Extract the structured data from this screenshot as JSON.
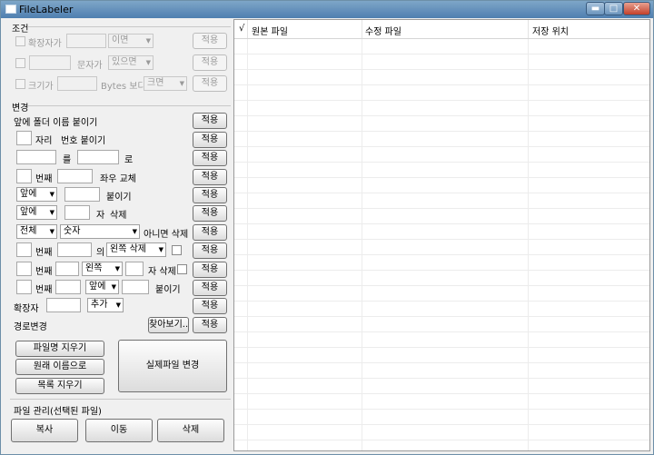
{
  "window": {
    "title": "FileLabeler",
    "min_glyph": "▬",
    "max_glyph": "□",
    "close_glyph": "✕"
  },
  "conditions": {
    "section_label": "조건",
    "ext_label": "확장자가",
    "ext_op": "이면",
    "char_op_label": "문자가",
    "char_op": "있으면",
    "size_label": "크기가",
    "size_unit": "Bytes 보다",
    "size_op": "크면"
  },
  "change": {
    "section_label": "변경",
    "folder_prefix_label": "앞에 폴더 이름 붙이기",
    "digit_label": "자리",
    "number_label": "번호 붙이기",
    "replace_mid": "를",
    "replace_end": "로",
    "swap_nth": "번째",
    "swap_label": "좌우 교체",
    "attach_pos": "앞에",
    "attach_label": "붙이기",
    "delete_pos": "앞에",
    "delete_ch": "자",
    "delete_label": "삭제",
    "filter_scope": "전체",
    "filter_type": "숫자",
    "filter_label": "아니면 삭제",
    "row8_nth": "번째",
    "row8_of": "의",
    "row8_op": "왼쪽 삭제",
    "row9_nth": "번째",
    "row9_side": "왼쪽",
    "row9_label": "자 삭제",
    "row10_nth": "번째",
    "row10_pos": "앞에",
    "row10_label": "붙이기",
    "ext_label": "확장자",
    "ext_op": "추가",
    "path_label": "경로변경",
    "browse": "찾아보기..",
    "apply": "적용"
  },
  "actions": {
    "clear_names": "파일명 지우기",
    "restore_names": "원래 이름으로",
    "clear_list": "목록 지우기",
    "apply_real": "실제파일 변경"
  },
  "file_mgmt": {
    "section_label": "파일 관리(선택된 파일)",
    "copy": "복사",
    "move": "이동",
    "delete": "삭제"
  },
  "grid": {
    "check_col": "√",
    "col_original": "원본 파일",
    "col_modified": "수정 파일",
    "col_location": "저장 위치"
  },
  "icons": {
    "dropdown": "▼"
  }
}
